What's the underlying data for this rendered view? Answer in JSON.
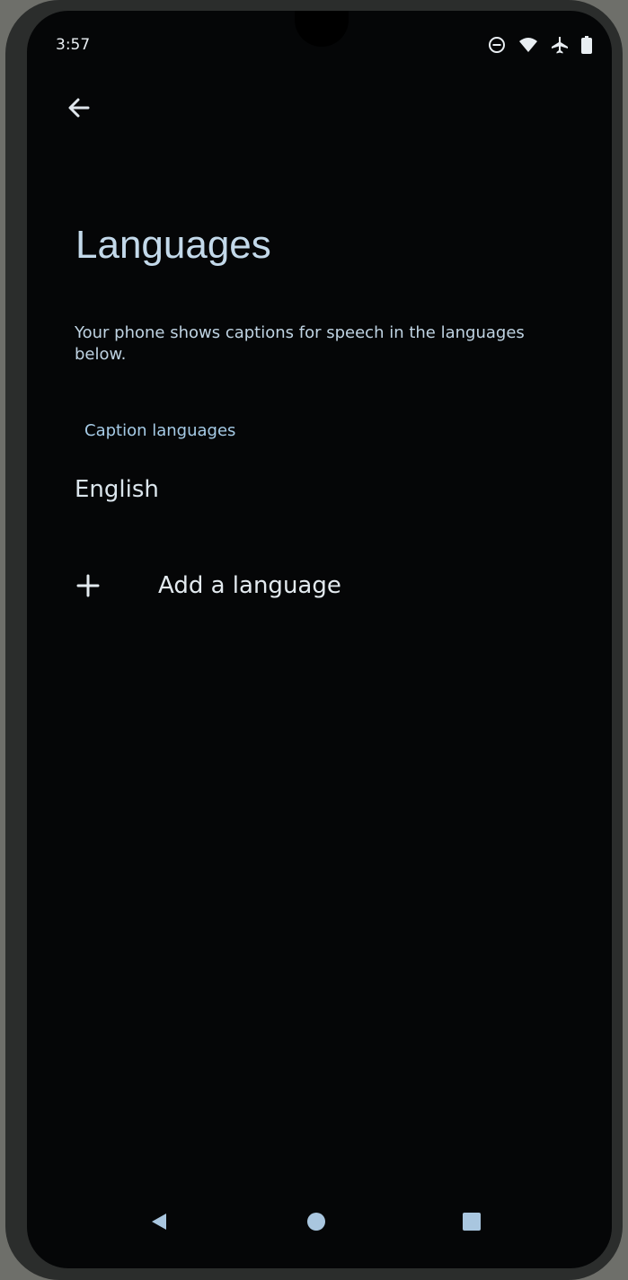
{
  "status_bar": {
    "time": "3:57",
    "icons": [
      "do-not-disturb-icon",
      "wifi-icon",
      "airplane-icon",
      "battery-icon"
    ]
  },
  "header": {
    "back_icon": "arrow-left-icon",
    "title": "Languages"
  },
  "main": {
    "description": "Your phone shows captions for speech in the languages below.",
    "section_title": "Caption languages",
    "languages": [
      "English"
    ],
    "add_language_label": "Add a language",
    "add_icon": "plus-icon"
  },
  "nav_bar": {
    "buttons": [
      "back-triangle-icon",
      "home-circle-icon",
      "recents-square-icon"
    ]
  },
  "colors": {
    "background": "#050607",
    "title": "#c3d9ea",
    "accent": "#a6cbe6",
    "text": "#dfe6ec"
  }
}
